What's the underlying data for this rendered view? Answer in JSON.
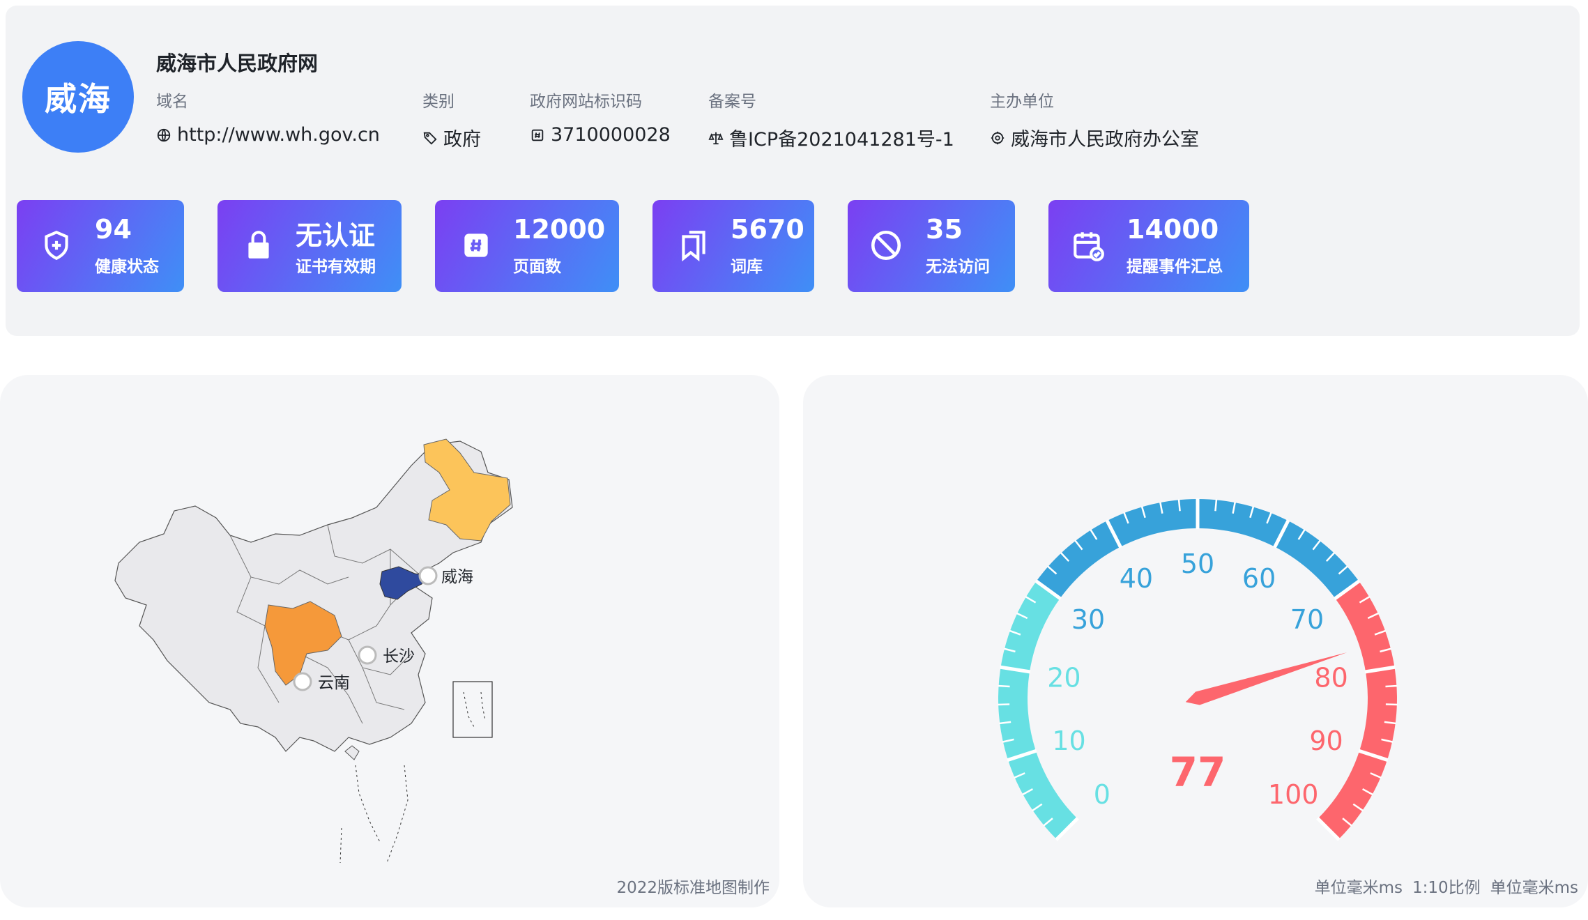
{
  "site": {
    "logo_text": "威海",
    "title": "威海市人民政府网",
    "meta": [
      {
        "label": "域名",
        "value": "http://www.wh.gov.cn",
        "icon": "globe-icon"
      },
      {
        "label": "类别",
        "value": "政府",
        "icon": "tag-icon"
      },
      {
        "label": "政府网站标识码",
        "value": "3710000028",
        "icon": "hash-icon"
      },
      {
        "label": "备案号",
        "value": "鲁ICP备2021041281号-1",
        "icon": "scale-icon"
      },
      {
        "label": "主办单位",
        "value": "威海市人民政府办公室",
        "icon": "org-icon"
      }
    ]
  },
  "stats": [
    {
      "value": "94",
      "label": "健康状态",
      "icon": "shield-plus-icon"
    },
    {
      "value": "无认证",
      "label": "证书有效期",
      "icon": "lock-icon"
    },
    {
      "value": "12000",
      "label": "页面数",
      "icon": "hash-square-icon"
    },
    {
      "value": "5670",
      "label": "词库",
      "icon": "bookmark-icon"
    },
    {
      "value": "35",
      "label": "无法访问",
      "icon": "ban-icon"
    },
    {
      "value": "14000",
      "label": "提醒事件汇总",
      "icon": "calendar-check-icon"
    }
  ],
  "map": {
    "markers": [
      {
        "label": "威海"
      },
      {
        "label": "长沙"
      },
      {
        "label": "云南"
      }
    ],
    "caption": "2022版标准地图制作",
    "colors": {
      "highlight_blue": "#2f4a9e",
      "orange": "#f5993a",
      "yellow": "#fcc45a",
      "base": "#e9e9ec"
    }
  },
  "gauge": {
    "value": 77,
    "value_text": "77",
    "min": 0,
    "max": 100,
    "tick_labels": [
      "0",
      "10",
      "20",
      "30",
      "40",
      "50",
      "60",
      "70",
      "80",
      "90",
      "100"
    ],
    "bands": [
      {
        "from": 0,
        "to": 30,
        "color": "#67e0e3"
      },
      {
        "from": 30,
        "to": 70,
        "color": "#37a2da"
      },
      {
        "from": 70,
        "to": 100,
        "color": "#fd666d"
      }
    ],
    "caption_parts": [
      "单位毫米ms",
      "1:10比例",
      "单位毫米ms"
    ]
  }
}
